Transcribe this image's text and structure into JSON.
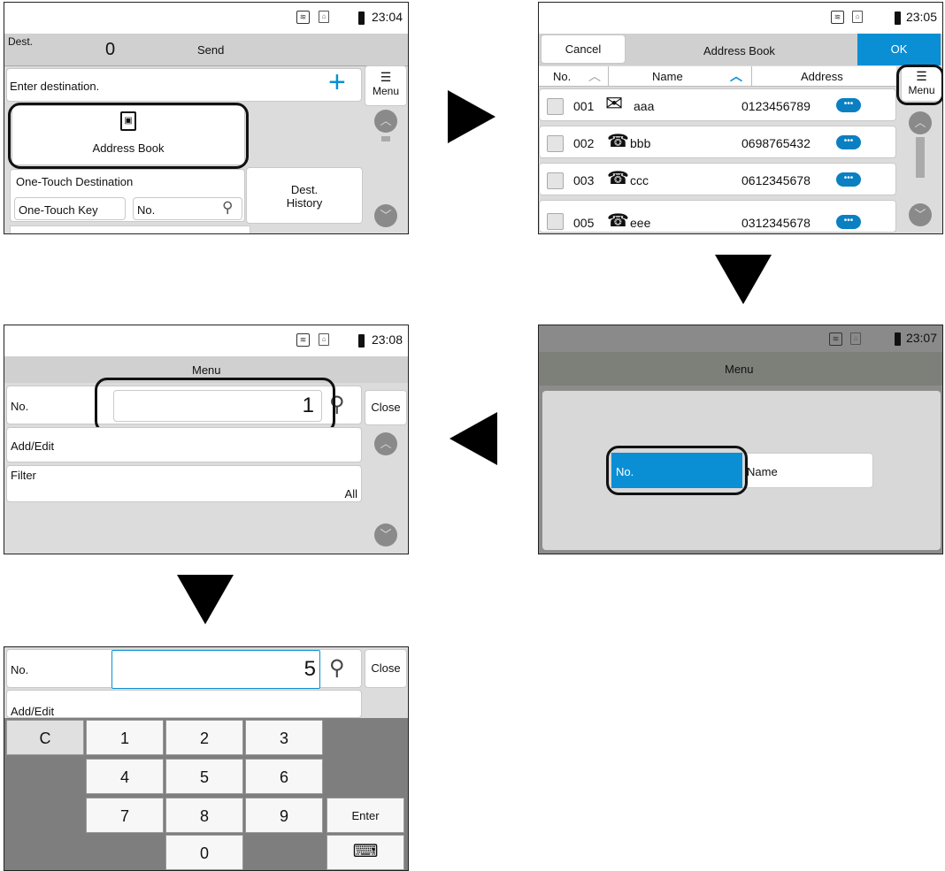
{
  "flow_arrows": [
    "right",
    "down",
    "left",
    "down"
  ],
  "screen1": {
    "time": "23:04",
    "dest_label": "Dest.",
    "dest_count": "0",
    "send_label": "Send",
    "enter_destination": "Enter destination.",
    "menu_label": "Menu",
    "address_book": "Address Book",
    "one_touch_destination": "One-Touch Destination",
    "one_touch_key": "One-Touch Key",
    "no_field": "No.",
    "dest_history_line1": "Dest.",
    "dest_history_line2": "History"
  },
  "screen2": {
    "time": "23:05",
    "cancel": "Cancel",
    "title": "Address Book",
    "ok": "OK",
    "col_no": "No.",
    "col_name": "Name",
    "col_address": "Address",
    "menu_label": "Menu",
    "entries": [
      {
        "no": "001",
        "type": "mail",
        "name": "aaa",
        "address": "0123456789"
      },
      {
        "no": "002",
        "type": "fax",
        "name": "bbb",
        "address": "0698765432"
      },
      {
        "no": "003",
        "type": "fax",
        "name": "ccc",
        "address": "0612345678"
      },
      {
        "no": "005",
        "type": "fax",
        "name": "eee",
        "address": "0312345678"
      }
    ]
  },
  "screen3": {
    "time": "23:07",
    "title": "Menu",
    "option_no": "No.",
    "option_name": "Name",
    "accent": "#0a8fd4"
  },
  "screen4": {
    "time": "23:08",
    "title": "Menu",
    "no_label": "No.",
    "no_value": "1",
    "close": "Close",
    "add_edit": "Add/Edit",
    "filter": "Filter",
    "filter_value": "All"
  },
  "screen5": {
    "no_label": "No.",
    "no_value": "5",
    "close": "Close",
    "add_edit": "Add/Edit",
    "keys": {
      "clear": "C",
      "k1": "1",
      "k2": "2",
      "k3": "3",
      "k4": "4",
      "k5": "5",
      "k6": "6",
      "k7": "7",
      "k8": "8",
      "k9": "9",
      "k0": "0",
      "enter": "Enter"
    }
  }
}
